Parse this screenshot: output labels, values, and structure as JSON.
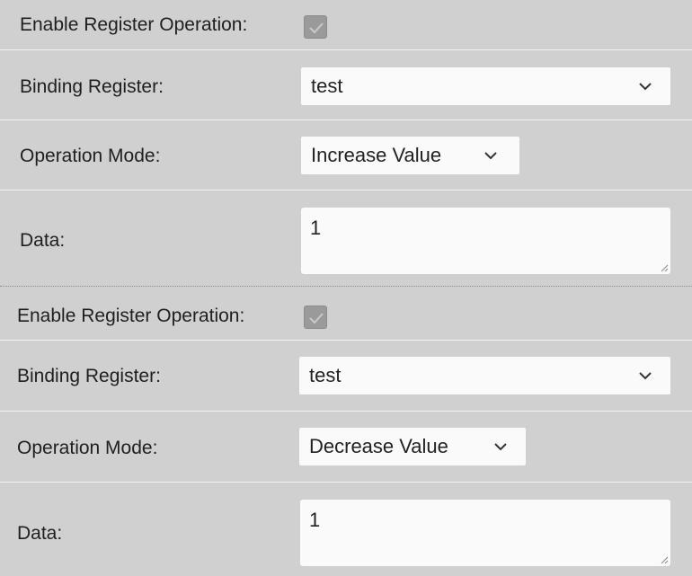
{
  "groups": [
    {
      "enable_label": "Enable Register Operation:",
      "enable_checked": true,
      "binding_label": "Binding Register:",
      "binding_value": "test",
      "mode_label": "Operation Mode:",
      "mode_value": "Increase Value",
      "data_label": "Data:",
      "data_value": "1"
    },
    {
      "enable_label": "Enable Register Operation:",
      "enable_checked": true,
      "binding_label": "Binding Register:",
      "binding_value": "test",
      "mode_label": "Operation Mode:",
      "mode_value": "Decrease Value",
      "data_label": "Data:",
      "data_value": "1"
    }
  ],
  "icons": {
    "checkmark": "check-icon",
    "dropdown": "chevron-down-icon",
    "resize": "resize-grip-icon"
  }
}
